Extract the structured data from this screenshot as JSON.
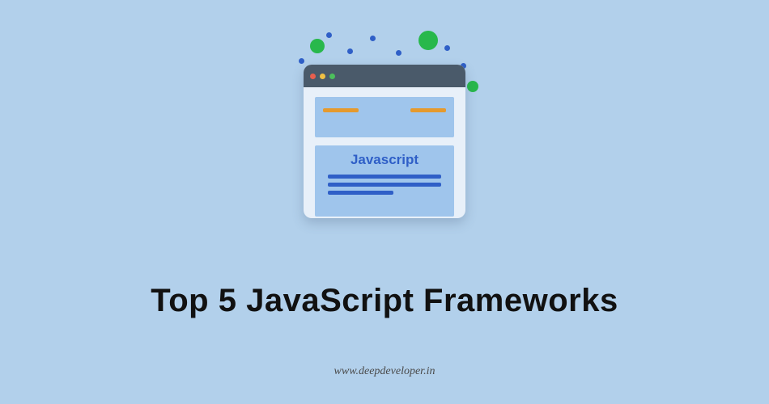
{
  "title": "Top 5 JavaScript Frameworks",
  "footer": "www.deepdeveloper.in",
  "illustration": {
    "badge_text": "Javascript"
  }
}
